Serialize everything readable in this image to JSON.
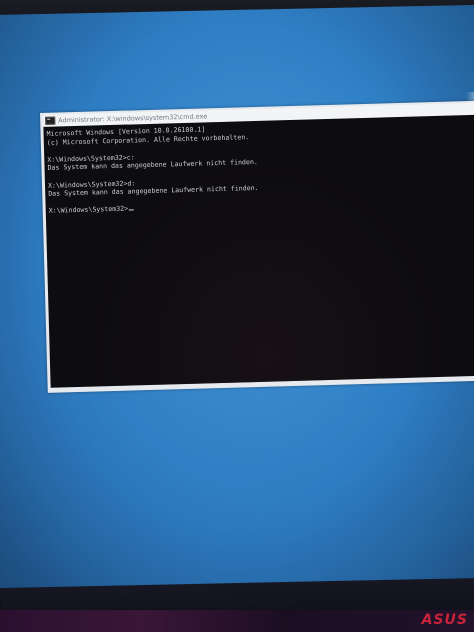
{
  "window": {
    "title": "Administrator: X:\\windows\\system32\\cmd.exe"
  },
  "console": {
    "lines": [
      "Microsoft Windows [Version 10.0.26100.1]",
      "(c) Microsoft Corporation. Alle Rechte vorbehalten.",
      "",
      "X:\\Windows\\System32>c:",
      "Das System kann das angegebene Laufwerk nicht finden.",
      "",
      "X:\\Windows\\System32>d:",
      "Das System kann das angegebene Laufwerk nicht finden.",
      "",
      "X:\\Windows\\System32>"
    ]
  },
  "brand": {
    "logo_text": "ASUS"
  },
  "colors": {
    "desktop_blue": "#2f7fc6",
    "console_bg": "#0d0c10",
    "console_text": "#c9ccd2",
    "titlebar_bg": "#f2f4f6",
    "brand_red": "#c8233a"
  }
}
